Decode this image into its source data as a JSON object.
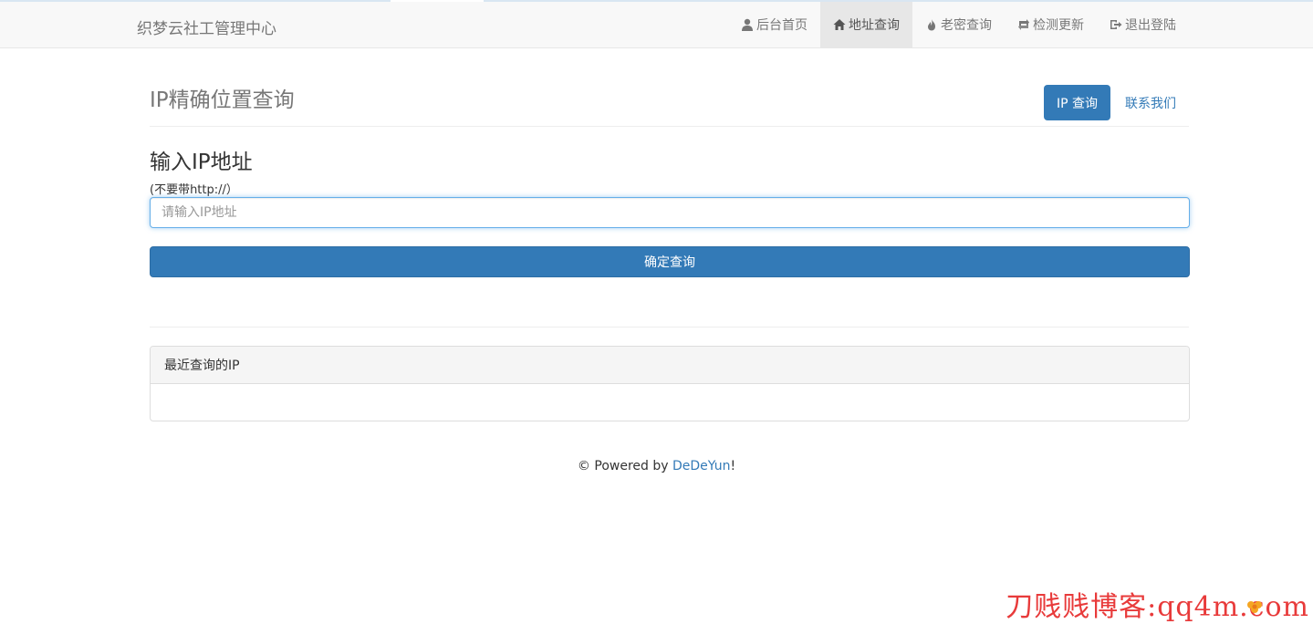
{
  "app": {
    "brand": "织梦云社工管理中心"
  },
  "nav": {
    "items": [
      {
        "label": "后台首页",
        "icon": "user-icon",
        "active": false
      },
      {
        "label": "地址查询",
        "icon": "home-icon",
        "active": true
      },
      {
        "label": "老密查询",
        "icon": "fire-icon",
        "active": false
      },
      {
        "label": "检测更新",
        "icon": "retweet-icon",
        "active": false
      },
      {
        "label": "退出登陆",
        "icon": "logout-icon",
        "active": false
      }
    ]
  },
  "header": {
    "title": "IP精确位置查询",
    "pills": [
      {
        "label": "IP 查询",
        "active": true
      },
      {
        "label": "联系我们",
        "active": false
      }
    ]
  },
  "form": {
    "section_title": "输入IP地址",
    "hint": "(不要带http://）",
    "input_placeholder": "请输入IP地址",
    "input_value": "",
    "submit_label": "确定查询"
  },
  "panel": {
    "heading": "最近查询的IP"
  },
  "footer": {
    "prefix": "© Powered by ",
    "link": "DeDeYun",
    "suffix": "!"
  },
  "watermark": {
    "text": "刀贱贱博客:qq4m.com"
  },
  "colors": {
    "primary": "#337ab7",
    "navbar_bg": "#f8f8f8",
    "watermark": "#e83a3a"
  }
}
